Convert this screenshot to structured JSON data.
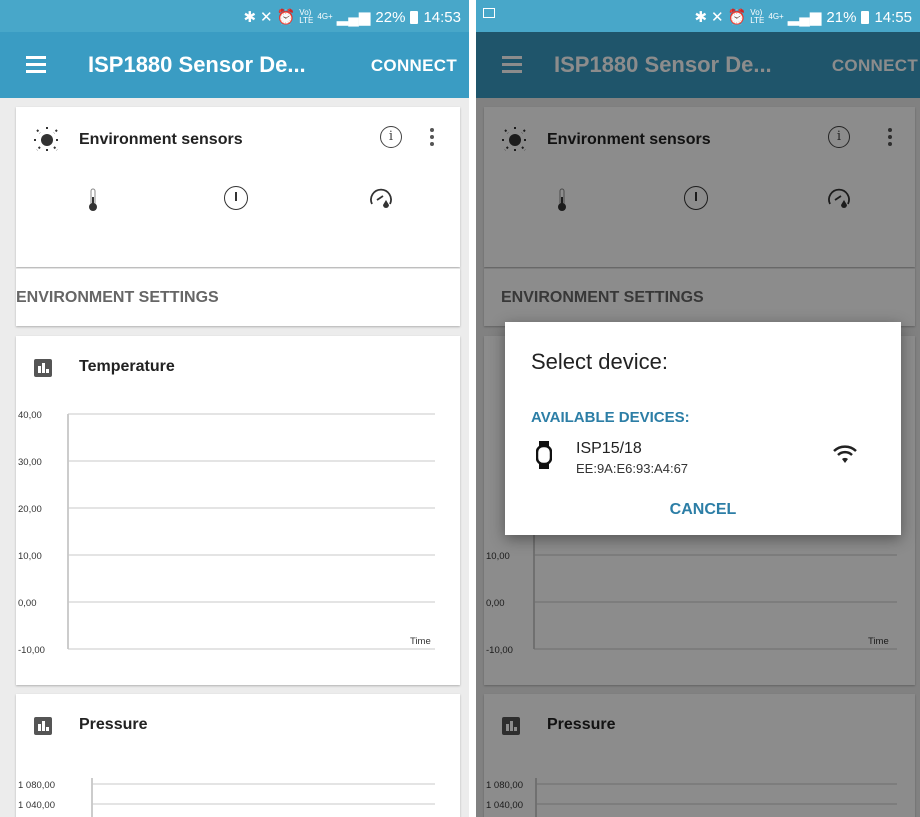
{
  "left_screen": {
    "status": {
      "battery_percent": "22%",
      "time": "14:53",
      "volte": "Vo)",
      "lte": "LTE",
      "network": "4G+"
    },
    "app_title": "ISP1880 Sensor De...",
    "connect_label": "CONNECT",
    "env_title": "Environment sensors",
    "info_glyph": "i",
    "settings_label": "ENVIRONMENT SETTINGS",
    "temp_title": "Temperature",
    "temp_ticks": [
      "40,00",
      "30,00",
      "20,00",
      "10,00",
      "0,00",
      "-10,00"
    ],
    "x_axis_label": "Time",
    "pressure_title": "Pressure",
    "pressure_ticks": [
      "1 080,00",
      "1 040,00"
    ]
  },
  "right_screen": {
    "status": {
      "battery_percent": "21%",
      "time": "14:55",
      "volte": "Vo)",
      "lte": "LTE",
      "network": "4G+"
    },
    "app_title": "ISP1880 Sensor De...",
    "connect_label": "CONNECT",
    "env_title": "Environment sensors",
    "info_glyph": "i",
    "settings_label": "ENVIRONMENT SETTINGS",
    "temp_ticks": [
      "10,00",
      "0,00",
      "-10,00"
    ],
    "x_axis_label": "Time",
    "pressure_title": "Pressure",
    "pressure_ticks": [
      "1 080,00",
      "1 040,00"
    ],
    "dialog": {
      "title": "Select device:",
      "subtitle": "AVAILABLE DEVICES:",
      "device_name": "ISP15/18",
      "device_address": "EE:9A:E6:93:A4:67",
      "cancel_label": "CANCEL"
    }
  },
  "colors": {
    "status_bar": "#48a7c9",
    "app_bar": "#3a9cc3",
    "accent": "#2c7ea6",
    "background": "#ececec"
  },
  "icons": [
    "menu-icon",
    "sun-icon",
    "info-icon",
    "more-vert-icon",
    "thermometer-icon",
    "circle-info-icon",
    "gauge-icon",
    "bar-chart-icon",
    "watch-icon",
    "wifi-icon",
    "bluetooth-icon",
    "mute-icon",
    "alarm-icon",
    "signal-icon",
    "battery-icon",
    "image-icon"
  ]
}
